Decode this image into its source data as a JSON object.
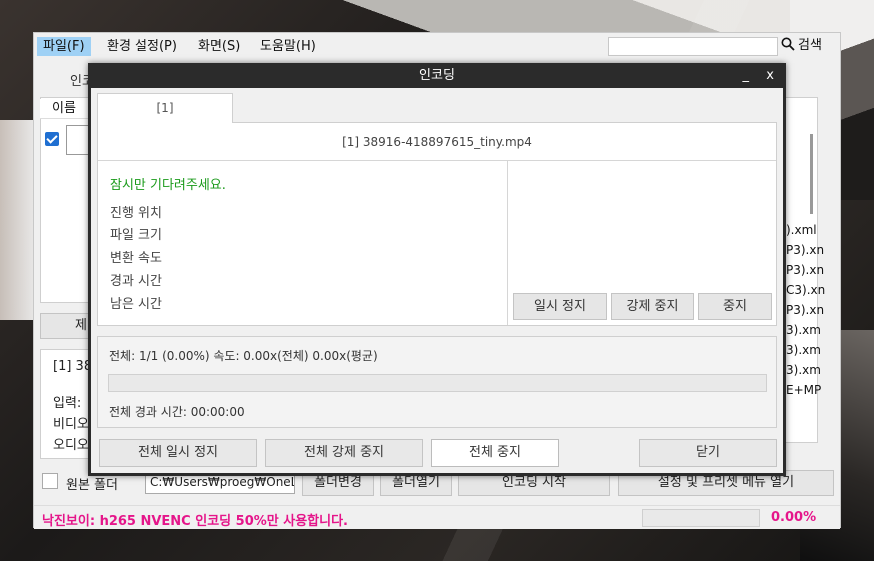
{
  "menu": {
    "items": [
      {
        "label": "파일(F)"
      },
      {
        "label": "환경 설정(P)"
      },
      {
        "label": "화면(S)"
      },
      {
        "label": "도움말(H)"
      }
    ],
    "search_label": "검색"
  },
  "app": {
    "column_name": "이름",
    "partial_encode_tab": "인코",
    "partial_job_button": "제",
    "info": {
      "job_line": "[1] 38",
      "input_label": "입력:",
      "video_label": "비디오",
      "audio_label": "오디오"
    },
    "right_list_items": [
      ").xml",
      "P3).xn",
      "P3).xn",
      "C3).xn",
      "P3).xn",
      "3).xm",
      "3).xm",
      "3).xm",
      "E+MP"
    ],
    "original_folder_label": "원본 폴더",
    "path_value": "C:₩Users₩proeg₩OneL",
    "buttons": {
      "change_folder": "폴더변경",
      "open_folder": "폴더열기",
      "start_encoding": "인코딩 시작",
      "settings_preset": "설정 및 프리셋 메뉴 열기"
    },
    "status": {
      "message": "낙진보이: h265 NVENC 인코딩 50%만 사용합니다.",
      "percent": "0.00%",
      "progress_fraction": 0
    }
  },
  "dialog": {
    "title": "인코딩",
    "minimize": "_",
    "close": "x",
    "tab_label": "[1]",
    "file_title": "[1] 38916-418897615_tiny.mp4",
    "wait_message": "잠시만 기다려주세요.",
    "progress_labels": [
      "진행 위치",
      "파일 크기",
      "변환 속도",
      "경과 시간",
      "남은 시간"
    ],
    "controls": {
      "pause": "일시 정지",
      "force_stop": "강제 중지",
      "stop": "중지"
    },
    "total": {
      "summary": "전체: 1/1 (0.00%) 속도: 0.00x(전체) 0.00x(평균)",
      "elapsed": "전체 경과 시간: 00:00:00",
      "progress_fraction": 0
    },
    "buttons": {
      "pause_all": "전체 일시 정지",
      "force_stop_all": "전체 강제 중지",
      "stop_all": "전체 중지",
      "close": "닫기"
    }
  },
  "colors": {
    "status_text": "#e5158a",
    "wait_text": "#1a9a1a",
    "menu_active": "#9fd1f5"
  }
}
